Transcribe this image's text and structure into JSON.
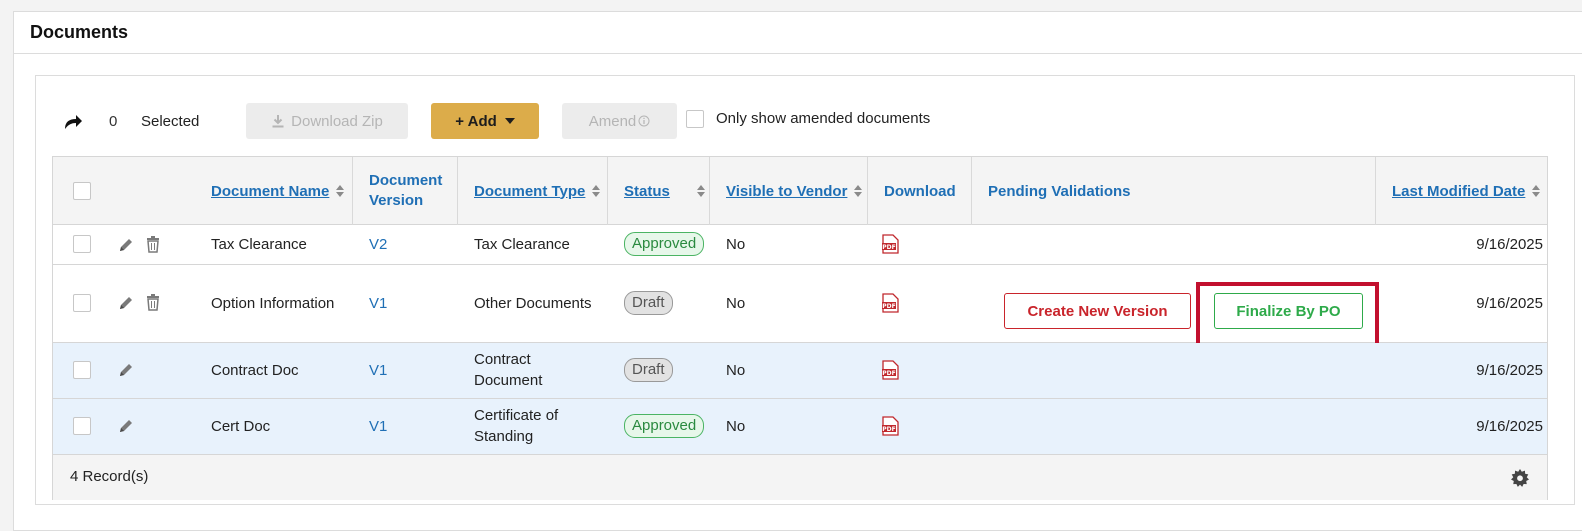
{
  "panel": {
    "title": "Documents"
  },
  "toolbar": {
    "selected_count": "0",
    "selected_label": "Selected",
    "download_zip_label": "Download Zip",
    "add_label": "+ Add",
    "amend_label": "Amend",
    "only_amended_label": "Only show amended documents"
  },
  "columns": {
    "name": "Document Name",
    "version": "Document Version",
    "type": "Document Type",
    "status": "Status",
    "visible": "Visible to Vendor",
    "download": "Download",
    "pending": "Pending Validations",
    "modified": "Last Modified Date"
  },
  "rows": [
    {
      "name": "Tax Clearance",
      "version": "V2",
      "type": "Tax Clearance",
      "status": "Approved",
      "visible": "No",
      "modified": "9/16/2025"
    },
    {
      "name": "Option Information",
      "version": "V1",
      "type": "Other Documents",
      "status": "Draft",
      "visible": "No",
      "modified": "9/16/2025",
      "actions": {
        "create_new_version": "Create New Version",
        "finalize_by_po": "Finalize By PO"
      }
    },
    {
      "name": "Contract Doc",
      "version": "V1",
      "type": "Contract Document",
      "status": "Draft",
      "visible": "No",
      "modified": "9/16/2025"
    },
    {
      "name": "Cert Doc",
      "version": "V1",
      "type": "Certificate of Standing",
      "status": "Approved",
      "visible": "No",
      "modified": "9/16/2025"
    }
  ],
  "footer": {
    "records": "4 Record(s)"
  },
  "colors": {
    "accent": "#1f6fb5",
    "add_button": "#dcac4a",
    "danger": "#c9242b",
    "success": "#2eaa4a",
    "highlight": "#c2102e"
  }
}
